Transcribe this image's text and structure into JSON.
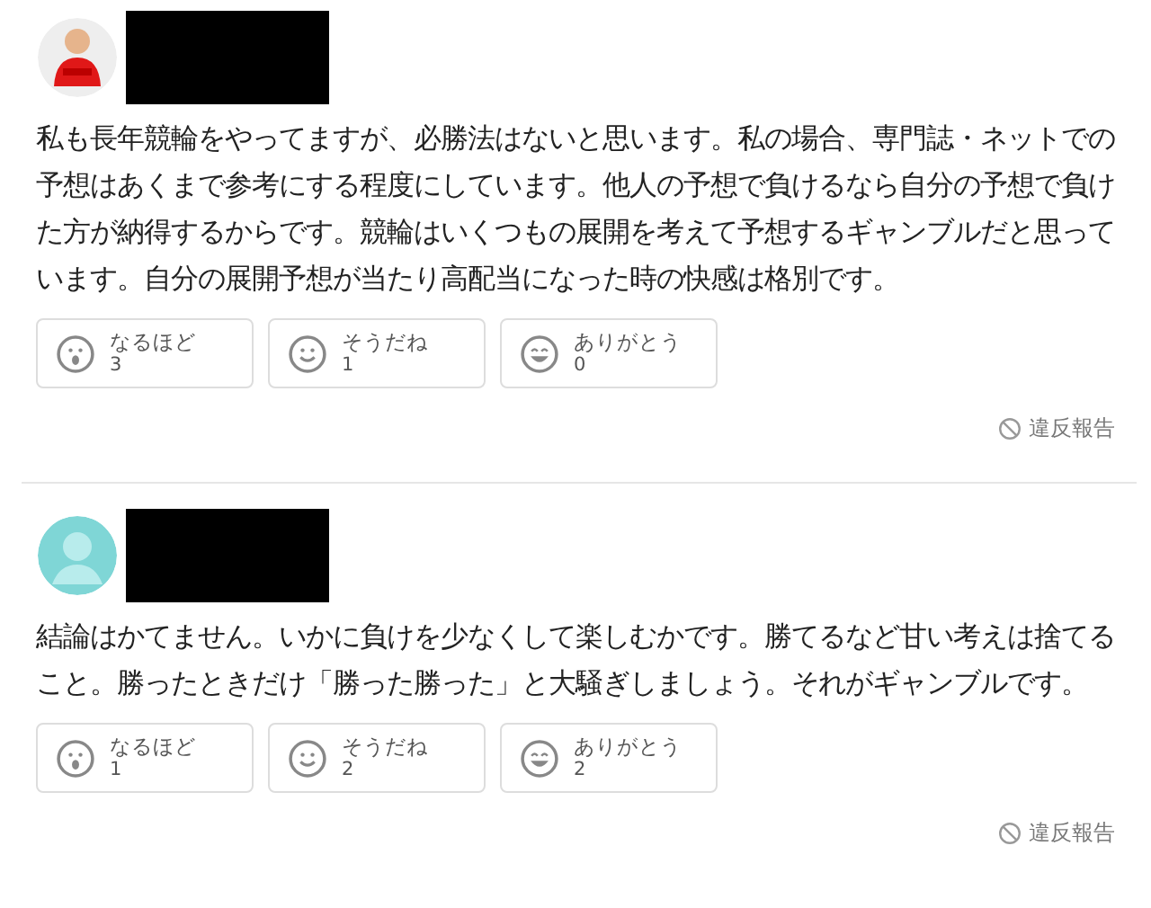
{
  "answers": [
    {
      "avatar": {
        "kind": "character"
      },
      "body": "私も長年競輪をやってますが、必勝法はないと思います。私の場合、専門誌・ネットでの予想はあくまで参考にする程度にしています。他人の予想で負けるなら自分の予想で負けた方が納得するからです。競輪はいくつもの展開を考えて予想するギャンブルだと思っています。自分の展開予想が当たり高配当になった時の快感は格別です。",
      "reactions": [
        {
          "kind": "surprised",
          "label": "なるほど",
          "count": "3"
        },
        {
          "kind": "smile",
          "label": "そうだね",
          "count": "1"
        },
        {
          "kind": "grin",
          "label": "ありがとう",
          "count": "0"
        }
      ],
      "report": "違反報告"
    },
    {
      "avatar": {
        "kind": "default"
      },
      "body": "結論はかてません。いかに負けを少なくして楽しむかです。勝てるなど甘い考えは捨てること。勝ったときだけ「勝った勝った」と大騒ぎしましょう。それがギャンブルです。",
      "reactions": [
        {
          "kind": "surprised",
          "label": "なるほど",
          "count": "1"
        },
        {
          "kind": "smile",
          "label": "そうだね",
          "count": "2"
        },
        {
          "kind": "grin",
          "label": "ありがとう",
          "count": "2"
        }
      ],
      "report": "違反報告"
    }
  ]
}
